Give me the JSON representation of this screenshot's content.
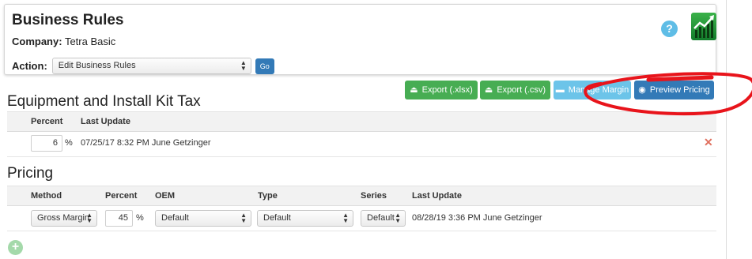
{
  "header": {
    "title": "Business Rules",
    "company_label": "Company:",
    "company_name": "Tetra Basic",
    "action_label": "Action:",
    "action_selected": "Edit Business Rules",
    "go_label": "Go",
    "help_glyph": "?"
  },
  "toolbar": {
    "export_xlsx": "Export (.xlsx)",
    "export_csv": "Export (.csv)",
    "manage_margin": "Manage Margin",
    "preview_pricing": "Preview Pricing"
  },
  "equipment_section": {
    "title": "Equipment and Install Kit Tax",
    "columns": [
      "Percent",
      "Last Update"
    ],
    "row": {
      "percent": "6",
      "unit": "%",
      "last_update": "07/25/17 8:32 PM June Getzinger"
    }
  },
  "pricing_section": {
    "title": "Pricing",
    "columns": [
      "Method",
      "Percent",
      "OEM",
      "Type",
      "Series",
      "Last Update"
    ],
    "row": {
      "method": "Gross Margin",
      "percent": "45",
      "unit": "%",
      "oem": "Default",
      "type": "Default",
      "series": "Default",
      "last_update": "08/28/19 3:36 PM June Getzinger"
    }
  },
  "colors": {
    "primary": "#337ab7",
    "success": "#47ad53",
    "info": "#6cc4e9",
    "danger": "#e0705f",
    "annotation": "#e8141b"
  },
  "icons": {
    "help": "question-icon",
    "logo": "chart-trend-logo",
    "export": "download-tray-icon",
    "manage_margin": "briefcase-icon",
    "preview": "eye-icon",
    "delete": "close-icon",
    "add": "plus-circle-icon"
  }
}
